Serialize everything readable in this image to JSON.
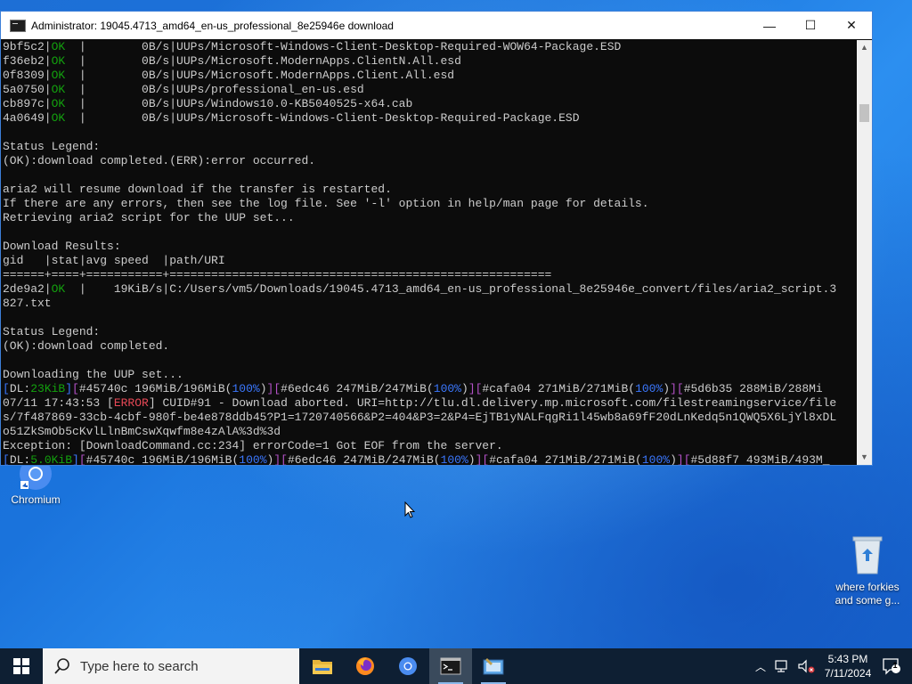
{
  "window": {
    "title": "Administrator:  19045.4713_amd64_en-us_professional_8e25946e download",
    "minimize": "—",
    "maximize": "☐",
    "close": "✕"
  },
  "console_lines": [
    [
      {
        "t": "9bf5c2|"
      },
      {
        "t": "OK",
        "c": "g"
      },
      {
        "t": "  |        0B/s|UUPs/Microsoft-Windows-Client-Desktop-Required-WOW64-Package.ESD"
      }
    ],
    [
      {
        "t": "f36eb2|"
      },
      {
        "t": "OK",
        "c": "g"
      },
      {
        "t": "  |        0B/s|UUPs/Microsoft.ModernApps.ClientN.All.esd"
      }
    ],
    [
      {
        "t": "0f8309|"
      },
      {
        "t": "OK",
        "c": "g"
      },
      {
        "t": "  |        0B/s|UUPs/Microsoft.ModernApps.Client.All.esd"
      }
    ],
    [
      {
        "t": "5a0750|"
      },
      {
        "t": "OK",
        "c": "g"
      },
      {
        "t": "  |        0B/s|UUPs/professional_en-us.esd"
      }
    ],
    [
      {
        "t": "cb897c|"
      },
      {
        "t": "OK",
        "c": "g"
      },
      {
        "t": "  |        0B/s|UUPs/Windows10.0-KB5040525-x64.cab"
      }
    ],
    [
      {
        "t": "4a0649|"
      },
      {
        "t": "OK",
        "c": "g"
      },
      {
        "t": "  |        0B/s|UUPs/Microsoft-Windows-Client-Desktop-Required-Package.ESD"
      }
    ],
    [
      {
        "t": ""
      }
    ],
    [
      {
        "t": "Status Legend:"
      }
    ],
    [
      {
        "t": "(OK):download completed.(ERR):error occurred."
      }
    ],
    [
      {
        "t": ""
      }
    ],
    [
      {
        "t": "aria2 will resume download if the transfer is restarted."
      }
    ],
    [
      {
        "t": "If there are any errors, then see the log file. See '-l' option in help/man page for details."
      }
    ],
    [
      {
        "t": "Retrieving aria2 script for the UUP set..."
      }
    ],
    [
      {
        "t": ""
      }
    ],
    [
      {
        "t": "Download Results:"
      }
    ],
    [
      {
        "t": "gid   |stat|avg speed  |path/URI"
      }
    ],
    [
      {
        "t": "======+====+===========+======================================================="
      }
    ],
    [
      {
        "t": "2de9a2|"
      },
      {
        "t": "OK",
        "c": "g"
      },
      {
        "t": "  |    19KiB/s|C:/Users/vm5/Downloads/19045.4713_amd64_en-us_professional_8e25946e_convert/files/aria2_script.3"
      }
    ],
    [
      {
        "t": "827.txt"
      }
    ],
    [
      {
        "t": ""
      }
    ],
    [
      {
        "t": "Status Legend:"
      }
    ],
    [
      {
        "t": "(OK):download completed."
      }
    ],
    [
      {
        "t": ""
      }
    ],
    [
      {
        "t": "Downloading the UUP set..."
      }
    ],
    [
      {
        "t": "[",
        "c": "b"
      },
      {
        "t": "DL:"
      },
      {
        "t": "23KiB",
        "c": "g"
      },
      {
        "t": "]",
        "c": "b"
      },
      {
        "t": "[",
        "c": "m"
      },
      {
        "t": "#45740c 196MiB/196MiB("
      },
      {
        "t": "100%",
        "c": "b"
      },
      {
        "t": ")"
      },
      {
        "t": "][",
        "c": "m"
      },
      {
        "t": "#6edc46 247MiB/247MiB("
      },
      {
        "t": "100%",
        "c": "b"
      },
      {
        "t": ")"
      },
      {
        "t": "][",
        "c": "m"
      },
      {
        "t": "#cafa04 271MiB/271MiB("
      },
      {
        "t": "100%",
        "c": "b"
      },
      {
        "t": ")"
      },
      {
        "t": "][",
        "c": "m"
      },
      {
        "t": "#5d6b35 288MiB/288Mi"
      }
    ],
    [
      {
        "t": "07/11 17:43:53 ["
      },
      {
        "t": "ERROR",
        "c": "r"
      },
      {
        "t": "] CUID#91 - Download aborted. URI=http://tlu.dl.delivery.mp.microsoft.com/filestreamingservice/file"
      }
    ],
    [
      {
        "t": "s/7f487869-33cb-4cbf-980f-be4e878ddb45?P1=1720740566&P2=404&P3=2&P4=EjTB1yNALFqgRi1l45wb8a69fF20dLnKedq5n1QWQ5X6LjYl8xDL"
      }
    ],
    [
      {
        "t": "o51ZkSmOb5cKvlLlnBmCswXqwfm8e4zAlA%3d%3d"
      }
    ],
    [
      {
        "t": "Exception: [DownloadCommand.cc:234] errorCode=1 Got EOF from the server."
      }
    ],
    [
      {
        "t": "[",
        "c": "b"
      },
      {
        "t": "DL:"
      },
      {
        "t": "5.0KiB",
        "c": "g"
      },
      {
        "t": "]",
        "c": "b"
      },
      {
        "t": "[",
        "c": "m"
      },
      {
        "t": "#45740c 196MiB/196MiB("
      },
      {
        "t": "100%",
        "c": "b"
      },
      {
        "t": ")"
      },
      {
        "t": "][",
        "c": "m"
      },
      {
        "t": "#6edc46 247MiB/247MiB("
      },
      {
        "t": "100%",
        "c": "b"
      },
      {
        "t": ")"
      },
      {
        "t": "][",
        "c": "m"
      },
      {
        "t": "#cafa04 271MiB/271MiB("
      },
      {
        "t": "100%",
        "c": "b"
      },
      {
        "t": ")"
      },
      {
        "t": "][",
        "c": "m"
      },
      {
        "t": "#5d88f7 493MiB/493M_"
      }
    ]
  ],
  "desktop_icons": {
    "chromium": "Chromium",
    "recycle_line1": "where forkies",
    "recycle_line2": "and some g..."
  },
  "taskbar": {
    "search_placeholder": "Type here to search",
    "time": "5:43 PM",
    "date": "7/11/2024",
    "notification_count": "1"
  },
  "colors": {
    "ok": "#13a10e",
    "error": "#e74856",
    "progress_bracket": "#b452c8",
    "accent": "#3b78ff"
  }
}
